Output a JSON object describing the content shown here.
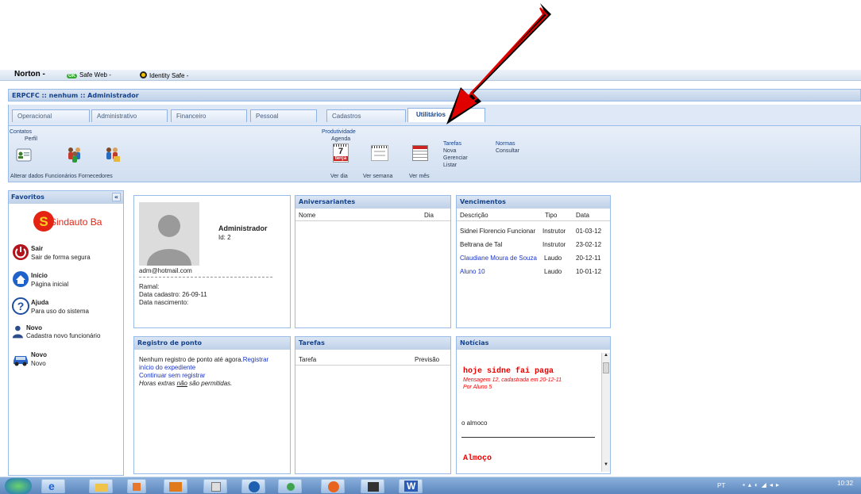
{
  "norton_toolbar": {
    "brand": "Norton -",
    "safe_web_badge": "OK",
    "safe_web": "Safe Web -",
    "identity_safe": "Identity Safe -"
  },
  "app_header": {
    "title": "ERPCFC :: nenhum :: Administrador"
  },
  "tabs": [
    "Operacional",
    "Administrativo",
    "Financeiro",
    "Pessoal",
    "Cadastros",
    "Utilitários"
  ],
  "ribbon": {
    "contatos": {
      "group_label": "Contatos",
      "perfil": "Perfil",
      "bottom_text": "Alterar dados Funcionários Fornecedores"
    },
    "produtividade": {
      "group_label": "Produtividade",
      "agenda": "Agenda",
      "calendar_day": "7",
      "calendar_weekday": "terça",
      "ver_dia": "Ver dia",
      "ver_semana": "Ver semana",
      "ver_mes": "Ver mês",
      "tarefas": "Tarefas",
      "nova": "Nova",
      "gerenciar": "Gerenciar",
      "listar": "Listar",
      "normas": "Normas",
      "consultar": "Consultar"
    }
  },
  "favorites": {
    "title": "Favoritos",
    "collapse": "«",
    "logo": "Sindauto Ba",
    "items": [
      {
        "title": "Sair",
        "subtitle": "Sair de forma segura"
      },
      {
        "title": "Início",
        "subtitle": "Página inicial"
      },
      {
        "title": "Ajuda",
        "subtitle": "Para uso do sistema"
      },
      {
        "title": "Novo",
        "subtitle": "Cadastra novo funcionário"
      },
      {
        "title": "Novo",
        "subtitle": "Novo"
      }
    ]
  },
  "profile": {
    "name": "Administrador",
    "id": "Id: 2",
    "email": "adm@hotmail.com",
    "ramal": "Ramal:",
    "data_cadastro": "Data cadastro: 26-09-11",
    "data_nascimento": "Data nascimento:"
  },
  "aniversariantes": {
    "title": "Aniversariantes",
    "col_nome": "Nome",
    "col_dia": "Dia"
  },
  "vencimentos": {
    "title": "Vencimentos",
    "col_descricao": "Descrição",
    "col_tipo": "Tipo",
    "col_data": "Data",
    "rows": [
      {
        "descricao": "Sidnei Florencio Funcionar",
        "tipo": "Instrutor",
        "data": "01-03-12"
      },
      {
        "descricao": "Beltrana de Tal",
        "tipo": "Instrutor",
        "data": "23-02-12"
      },
      {
        "descricao": "Claudiane Moura de Souza",
        "tipo": "Laudo",
        "data": "20-12-11"
      },
      {
        "descricao": "Aluno 10",
        "tipo": "Laudo",
        "data": "10-01-12"
      }
    ]
  },
  "registro": {
    "title": "Registro de ponto",
    "text": "Nenhum registro de ponto até agora.",
    "link_registrar": "Registrar",
    "link_inicio": "início do expediente",
    "link_continuar": "Continuar sem registrar",
    "horas_pre": "Horas extras ",
    "horas_nao": "não",
    "horas_post": " são permitidas."
  },
  "tarefas": {
    "title": "Tarefas",
    "col_tarefa": "Tarefa",
    "col_previsao": "Previsão"
  },
  "noticias": {
    "title": "Notícias",
    "headline": "hoje sidne fai paga",
    "meta": "Mensagem 12, cadastrada em 20-12-11",
    "author": "Por Aluno 5",
    "body": "o almoco",
    "headline2": "Almoço"
  },
  "taskbar": {
    "lang": "PT",
    "clock": "10:32"
  }
}
